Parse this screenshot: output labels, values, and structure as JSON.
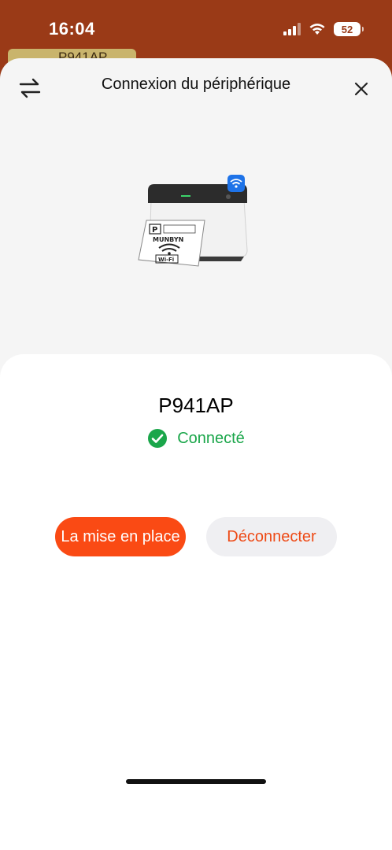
{
  "status_bar": {
    "time": "16:04",
    "battery": "52",
    "icons": [
      "signal-icon",
      "wifi-icon",
      "battery-icon"
    ]
  },
  "background": {
    "chip_text": "P941AP"
  },
  "header": {
    "title": "Connexion du périphérique",
    "left_icon": "swap-arrows-icon",
    "right_icon": "close-icon"
  },
  "illustration": {
    "label_brand": "MUNBYN",
    "label_text": "Wi-Fi"
  },
  "device": {
    "name": "P941AP",
    "status": "Connecté",
    "status_icon": "check-circle-icon"
  },
  "actions": {
    "setup_label": "La mise en place",
    "disconnect_label": "Déconnecter"
  },
  "colors": {
    "brand_orange": "#fa4a14",
    "status_green": "#1aa64a",
    "status_bar_bg": "#9a3a17"
  }
}
